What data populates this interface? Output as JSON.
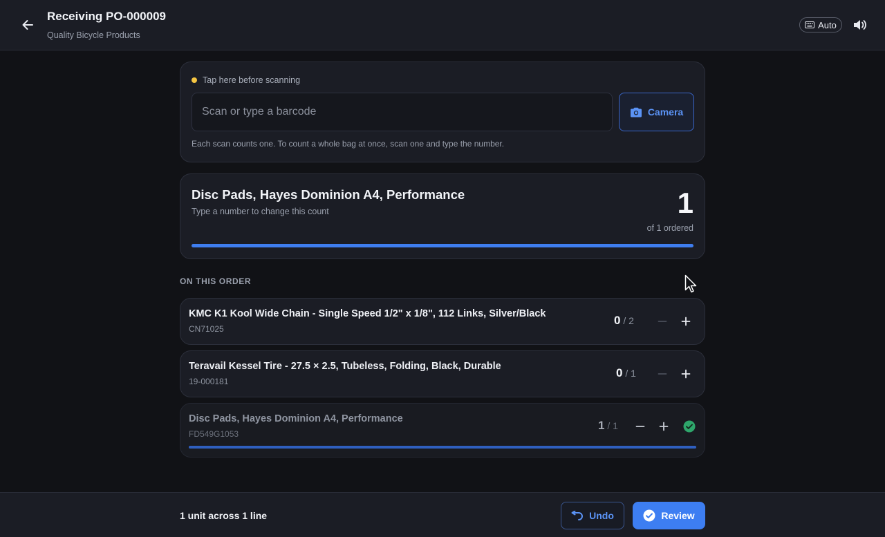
{
  "header": {
    "title": "Receiving PO-000009",
    "subtitle": "Quality Bicycle Products",
    "auto_label": "Auto"
  },
  "scan": {
    "hint": "Tap here before scanning",
    "placeholder": "Scan or type a barcode",
    "camera_label": "Camera",
    "note": "Each scan counts one. To count a whole bag at once, scan one and type the number."
  },
  "current_item": {
    "name": "Disc Pads, Hayes Dominion A4, Performance",
    "hint": "Type a number to change this count",
    "count": "1",
    "ordered": "of 1 ordered",
    "progress_fraction": 1.0
  },
  "order": {
    "section_label": "ON THIS ORDER",
    "lines": [
      {
        "name": "KMC K1 Kool Wide Chain - Single Speed 1/2\" x 1/8\", 112 Links, Silver/Black",
        "sku": "CN71025",
        "received": "0",
        "ordered": "/ 2"
      },
      {
        "name": "Teravail Kessel Tire - 27.5 × 2.5, Tubeless, Folding, Black, Durable",
        "sku": "19-000181",
        "received": "0",
        "ordered": "/ 1"
      },
      {
        "name": "Disc Pads, Hayes Dominion A4, Performance",
        "sku": "FD549G1053",
        "received": "1",
        "ordered": "/ 1",
        "complete": true,
        "progress_fraction": 1.0
      }
    ]
  },
  "footer": {
    "summary": "1 unit across 1 line",
    "undo_label": "Undo",
    "review_label": "Review"
  },
  "colors": {
    "accent": "#3d7ef2",
    "background": "#111216",
    "surface": "#1b1d25",
    "success": "#2ea66b",
    "warning_dot": "#f5c542"
  }
}
